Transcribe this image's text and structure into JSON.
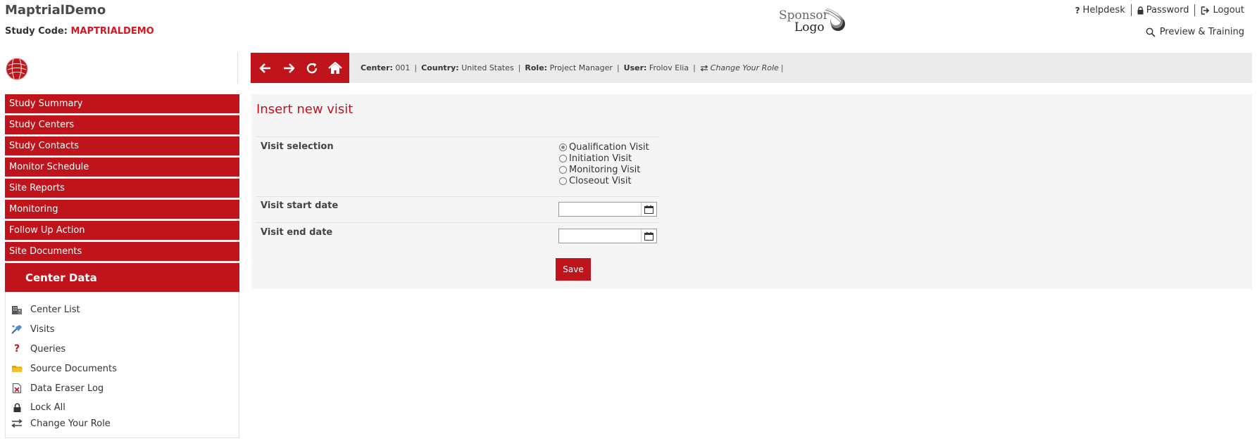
{
  "header": {
    "app_title": "MaptrialDemo",
    "study_code_label": "Study Code:",
    "study_code_value": "MAPTRIALDEMO",
    "sponsor_logo_line1": "Sponsor",
    "sponsor_logo_line2": "Logo",
    "links": {
      "helpdesk": "Helpdesk",
      "password": "Password",
      "logout": "Logout",
      "preview": "Preview & Training"
    }
  },
  "info_bar": {
    "center_label": "Center:",
    "center_value": "001",
    "country_label": "Country:",
    "country_value": "United States",
    "role_label": "Role:",
    "role_value": "Project Manager",
    "user_label": "User:",
    "user_value": "Frolov Elia",
    "change_role": "Change Your Role"
  },
  "sidebar": {
    "items": [
      {
        "label": "Study Summary"
      },
      {
        "label": "Study Centers"
      },
      {
        "label": "Study Contacts"
      },
      {
        "label": "Monitor Schedule"
      },
      {
        "label": "Site Reports"
      },
      {
        "label": "Monitoring"
      },
      {
        "label": "Follow Up Action"
      },
      {
        "label": "Site Documents"
      }
    ],
    "center_data_title": "Center Data",
    "center_data_items": [
      {
        "label": "Center List",
        "icon": "building-icon"
      },
      {
        "label": "Visits",
        "icon": "visits-icon"
      },
      {
        "label": "Queries",
        "icon": "question-icon"
      },
      {
        "label": "Source Documents",
        "icon": "folder-icon"
      },
      {
        "label": "Data Eraser Log",
        "icon": "document-x-icon"
      },
      {
        "label": "Lock All",
        "icon": "lock-icon"
      },
      {
        "label": "Change Your Role",
        "icon": "swap-icon"
      }
    ]
  },
  "form": {
    "title": "Insert new visit",
    "visit_selection_label": "Visit selection",
    "visit_options": [
      "Qualification Visit",
      "Initiation Visit",
      "Monitoring Visit",
      "Closeout Visit"
    ],
    "selected_option": "Qualification Visit",
    "start_date_label": "Visit start date",
    "start_date_value": "",
    "end_date_label": "Visit end date",
    "end_date_value": "",
    "save_label": "Save"
  },
  "colors": {
    "brand_red": "#c0141c",
    "code_red": "#d8141e",
    "info_bar_bg": "#ebebeb",
    "panel_bg": "#f5f5f5"
  }
}
